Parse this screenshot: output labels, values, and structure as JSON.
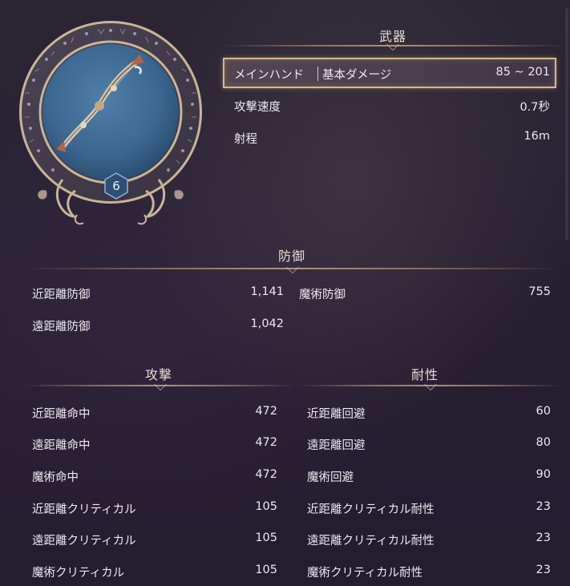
{
  "weapon": {
    "level": "6",
    "title": "武器",
    "main_hand": {
      "label": "メインハンド",
      "damage_label": "基本ダメージ",
      "damage_value": "85 ~ 201"
    },
    "rows": [
      {
        "label": "攻撃速度",
        "value": "0.7秒"
      },
      {
        "label": "射程",
        "value": "16m"
      }
    ]
  },
  "defense": {
    "title": "防御",
    "left": [
      {
        "label": "近距離防御",
        "value": "1,141"
      },
      {
        "label": "遠距離防御",
        "value": "1,042"
      }
    ],
    "right": [
      {
        "label": "魔術防御",
        "value": "755"
      }
    ]
  },
  "attack": {
    "title": "攻撃",
    "rows": [
      {
        "label": "近距離命中",
        "value": "472"
      },
      {
        "label": "遠距離命中",
        "value": "472"
      },
      {
        "label": "魔術命中",
        "value": "472"
      },
      {
        "label": "近距離クリティカル",
        "value": "105"
      },
      {
        "label": "遠距離クリティカル",
        "value": "105"
      },
      {
        "label": "魔術クリティカル",
        "value": "105"
      }
    ]
  },
  "resistance": {
    "title": "耐性",
    "rows": [
      {
        "label": "近距離回避",
        "value": "60"
      },
      {
        "label": "遠距離回避",
        "value": "80"
      },
      {
        "label": "魔術回避",
        "value": "90"
      },
      {
        "label": "近距離クリティカル耐性",
        "value": "23"
      },
      {
        "label": "遠距離クリティカル耐性",
        "value": "23"
      },
      {
        "label": "魔術クリティカル耐性",
        "value": "23"
      }
    ]
  },
  "colors": {
    "frame_gold": "#d6b98c",
    "emblem_blue": "#3f6c95",
    "text": "#ece8f0"
  },
  "icons": [
    "bow-icon",
    "level-hexagon-icon",
    "rune-ring-icon"
  ]
}
